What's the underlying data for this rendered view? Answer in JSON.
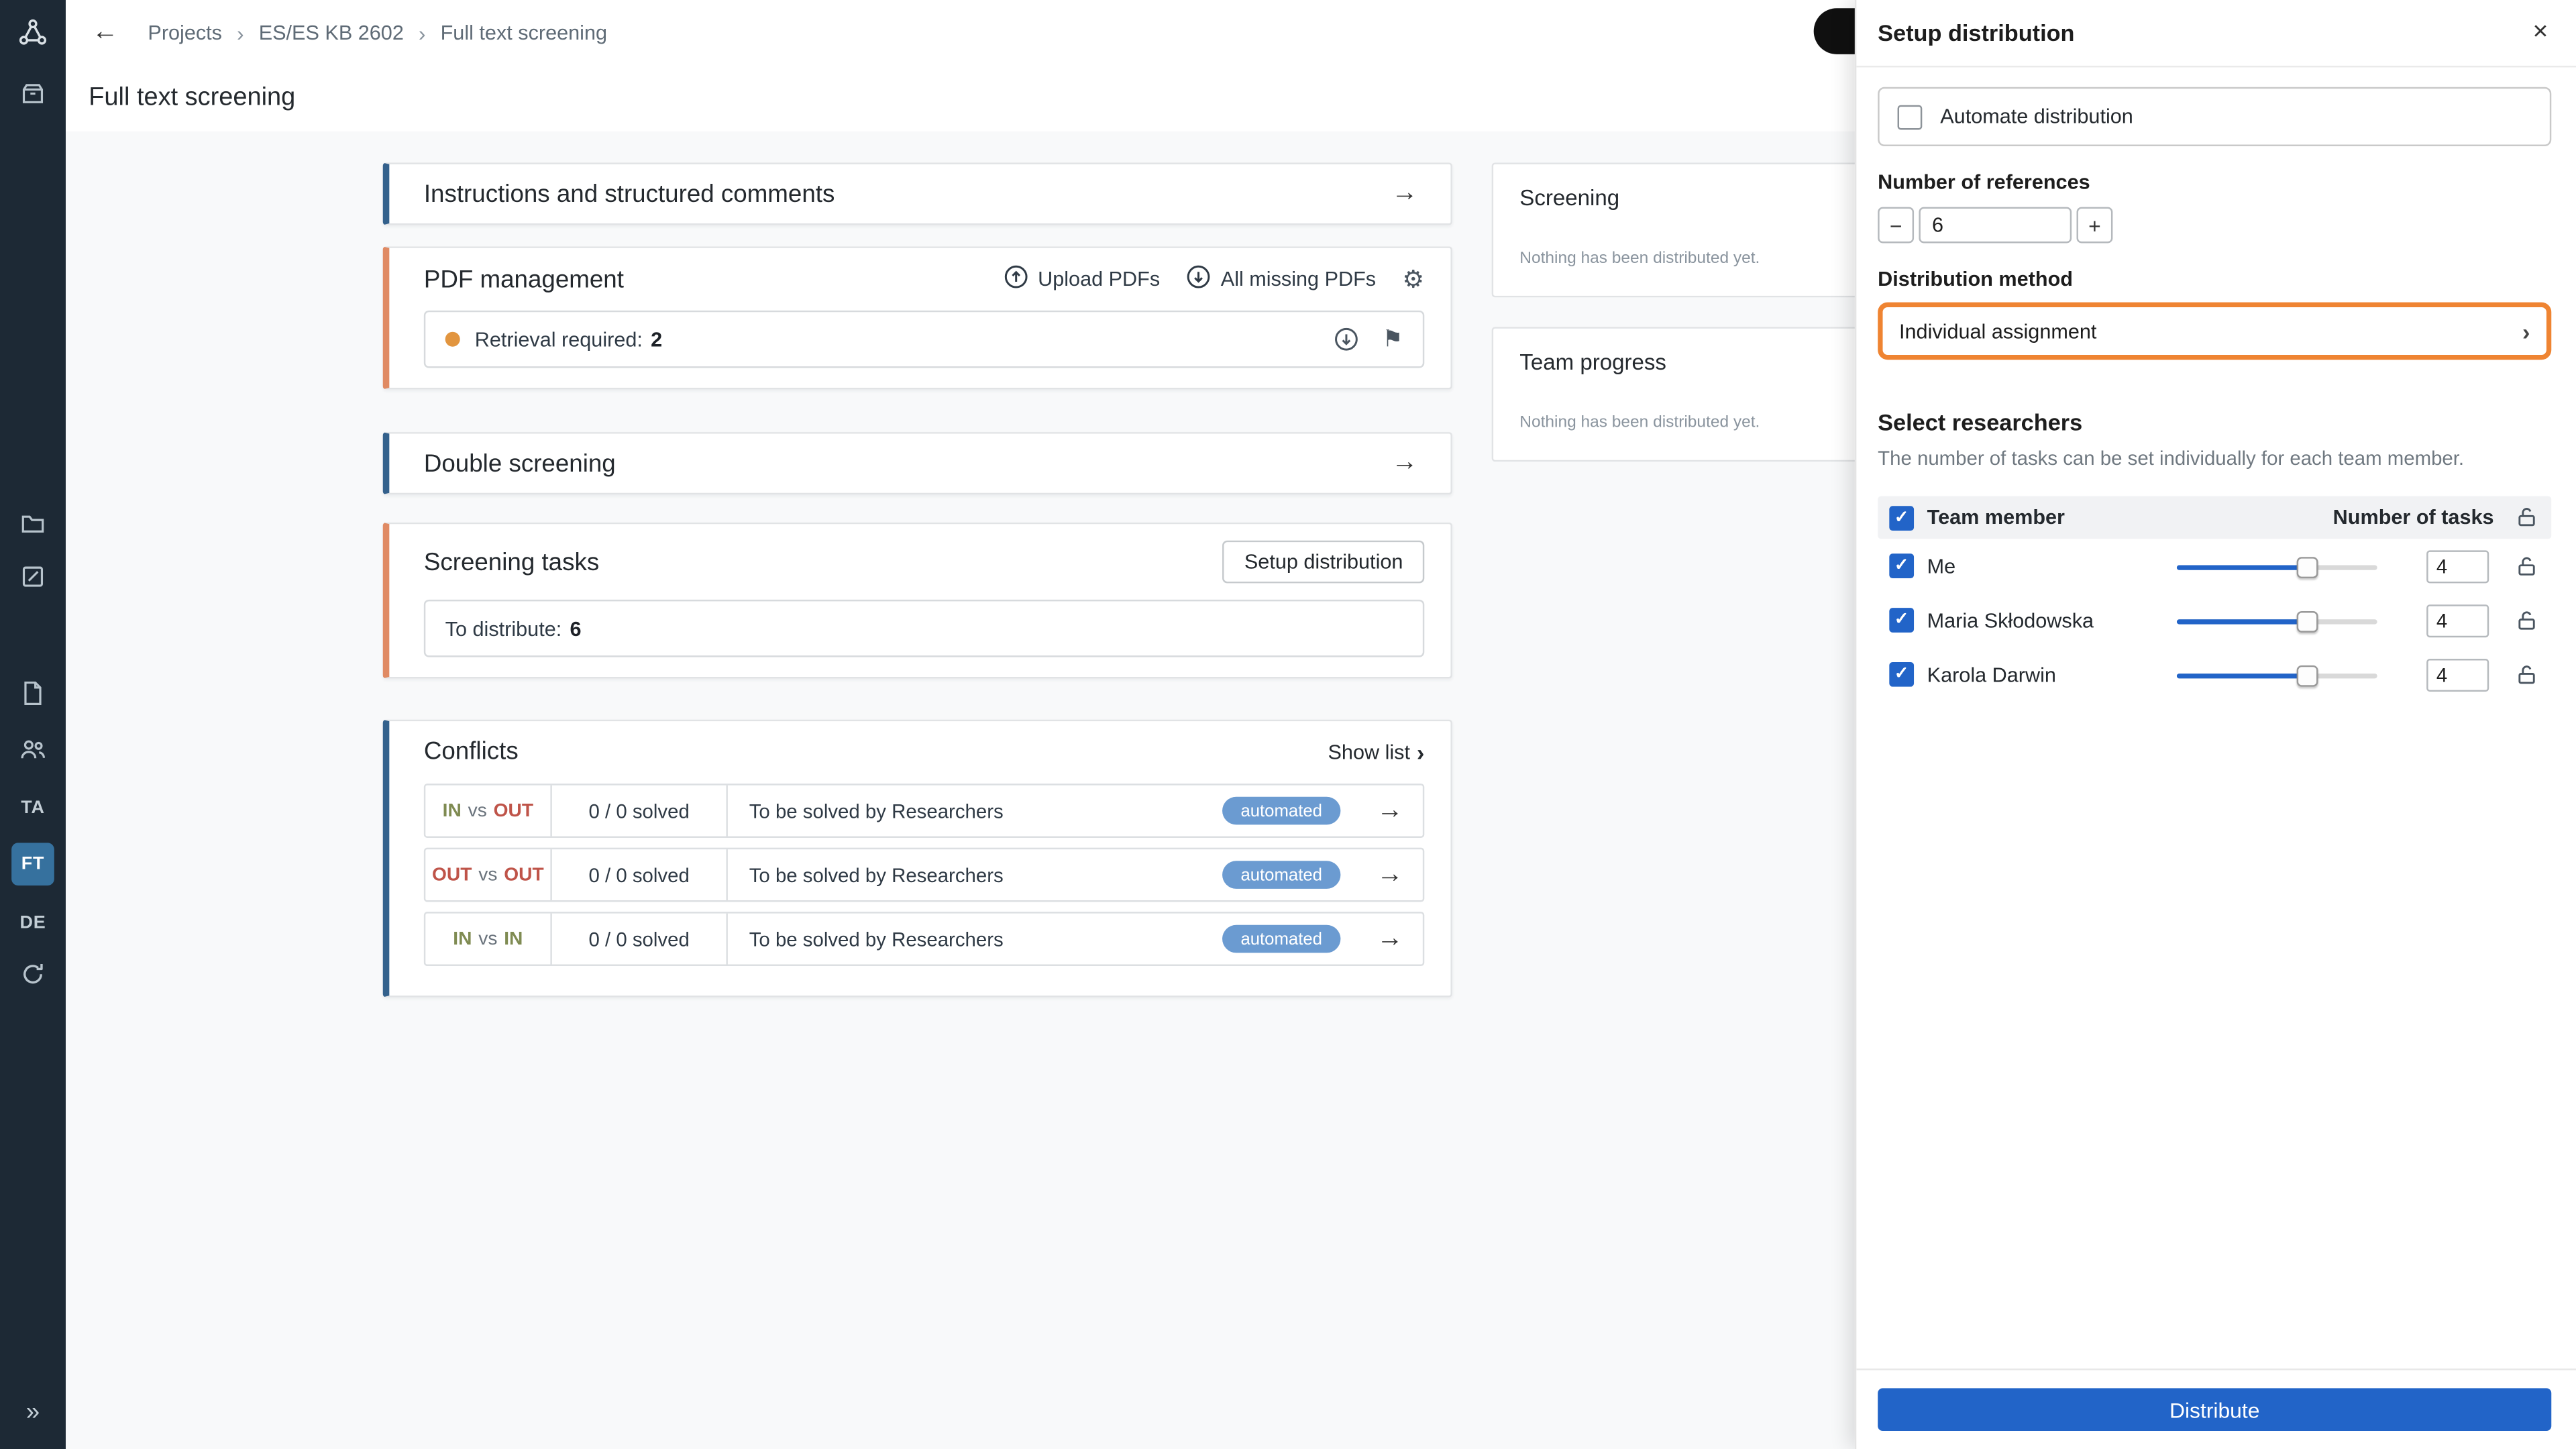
{
  "icons": {
    "back": "←",
    "crumb_sep": "›",
    "arrow": "→",
    "close": "×",
    "gear": "⚙",
    "flag": "⚑",
    "minus": "−",
    "plus": "+",
    "expand": "»",
    "check": "✓",
    "chevron": "›"
  },
  "sidebar": {
    "ta": "TA",
    "ft": "FT",
    "de": "DE"
  },
  "topbar": {
    "breadcrumb": [
      "Projects",
      "ES/ES KB 2602",
      "Full text screening"
    ]
  },
  "page": {
    "title": "Full text screening"
  },
  "cards": {
    "instructions": {
      "title": "Instructions and structured comments"
    },
    "pdf": {
      "title": "PDF management",
      "upload": "Upload PDFs",
      "all_missing": "All missing PDFs",
      "retrieval_label": "Retrieval required:",
      "retrieval_count": "2"
    },
    "double_screening": {
      "title": "Double screening"
    },
    "screening_tasks": {
      "title": "Screening tasks",
      "setup_button": "Setup distribution",
      "to_distribute_label": "To distribute:",
      "to_distribute_count": "6"
    },
    "conflicts": {
      "title": "Conflicts",
      "show_list": "Show list",
      "rows": [
        {
          "left": "IN",
          "vs": "vs",
          "right": "OUT",
          "solved": "0 / 0 solved",
          "assignee": "To be solved by Researchers",
          "badge": "automated"
        },
        {
          "left": "OUT",
          "vs": "vs",
          "right": "OUT",
          "solved": "0 / 0 solved",
          "assignee": "To be solved by Researchers",
          "badge": "automated"
        },
        {
          "left": "IN",
          "vs": "vs",
          "right": "IN",
          "solved": "0 / 0 solved",
          "assignee": "To be solved by Researchers",
          "badge": "automated"
        }
      ]
    }
  },
  "aside": {
    "screening": {
      "title": "Screening",
      "empty": "Nothing has been distributed yet."
    },
    "team_progress": {
      "title": "Team progress",
      "empty": "Nothing has been distributed yet."
    }
  },
  "panel": {
    "title": "Setup distribution",
    "automate": "Automate distribution",
    "references_label": "Number of references",
    "references_value": "6",
    "method_label": "Distribution method",
    "method_value": "Individual assignment",
    "select_title": "Select researchers",
    "select_hint": "The number of tasks can be set individually for each team member.",
    "member_header": "Team member",
    "tasks_header": "Number of tasks",
    "rows": [
      {
        "name": "Me",
        "tasks": "4"
      },
      {
        "name": "Maria Skłodowska",
        "tasks": "4"
      },
      {
        "name": "Karola Darwin",
        "tasks": "4"
      }
    ],
    "distribute": "Distribute"
  },
  "colors": {
    "accent_blue": "#34618c",
    "accent_orange": "#e08a63",
    "highlight_orange": "#ef8432",
    "primary_blue": "#2264c8",
    "badge_blue": "#6b9bd1",
    "in_green": "#7f8b52",
    "out_red": "#bf5449"
  }
}
